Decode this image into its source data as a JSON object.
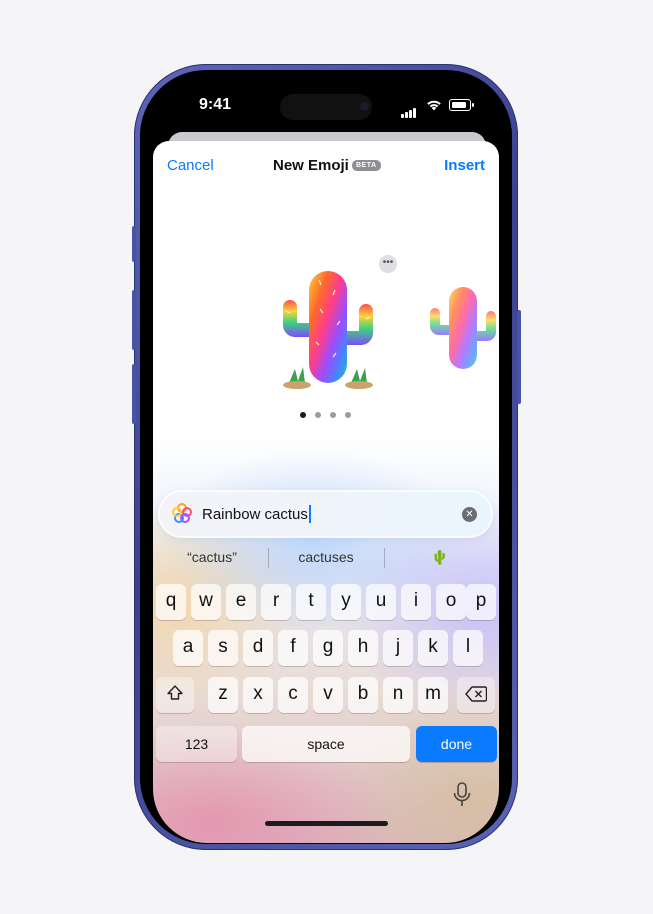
{
  "status_bar": {
    "time": "9:41"
  },
  "nav": {
    "cancel_label": "Cancel",
    "title": "New Emoji",
    "badge": "BETA",
    "insert_label": "Insert"
  },
  "preview": {
    "more_label": "•••",
    "page_count": 4,
    "current_page": 1
  },
  "input": {
    "value": "Rainbow cactus",
    "clear_symbol": "✕"
  },
  "suggestions": [
    "“cactus”",
    "cactuses",
    "🌵"
  ],
  "keyboard": {
    "row1": [
      "q",
      "w",
      "e",
      "r",
      "t",
      "y",
      "u",
      "i",
      "o",
      "p"
    ],
    "row2": [
      "a",
      "s",
      "d",
      "f",
      "g",
      "h",
      "j",
      "k",
      "l"
    ],
    "row3": [
      "z",
      "x",
      "c",
      "v",
      "b",
      "n",
      "m"
    ],
    "numbers_label": "123",
    "space_label": "space",
    "done_label": "done"
  },
  "colors": {
    "accent": "#0a7aff",
    "frame": "#4a52a3"
  }
}
